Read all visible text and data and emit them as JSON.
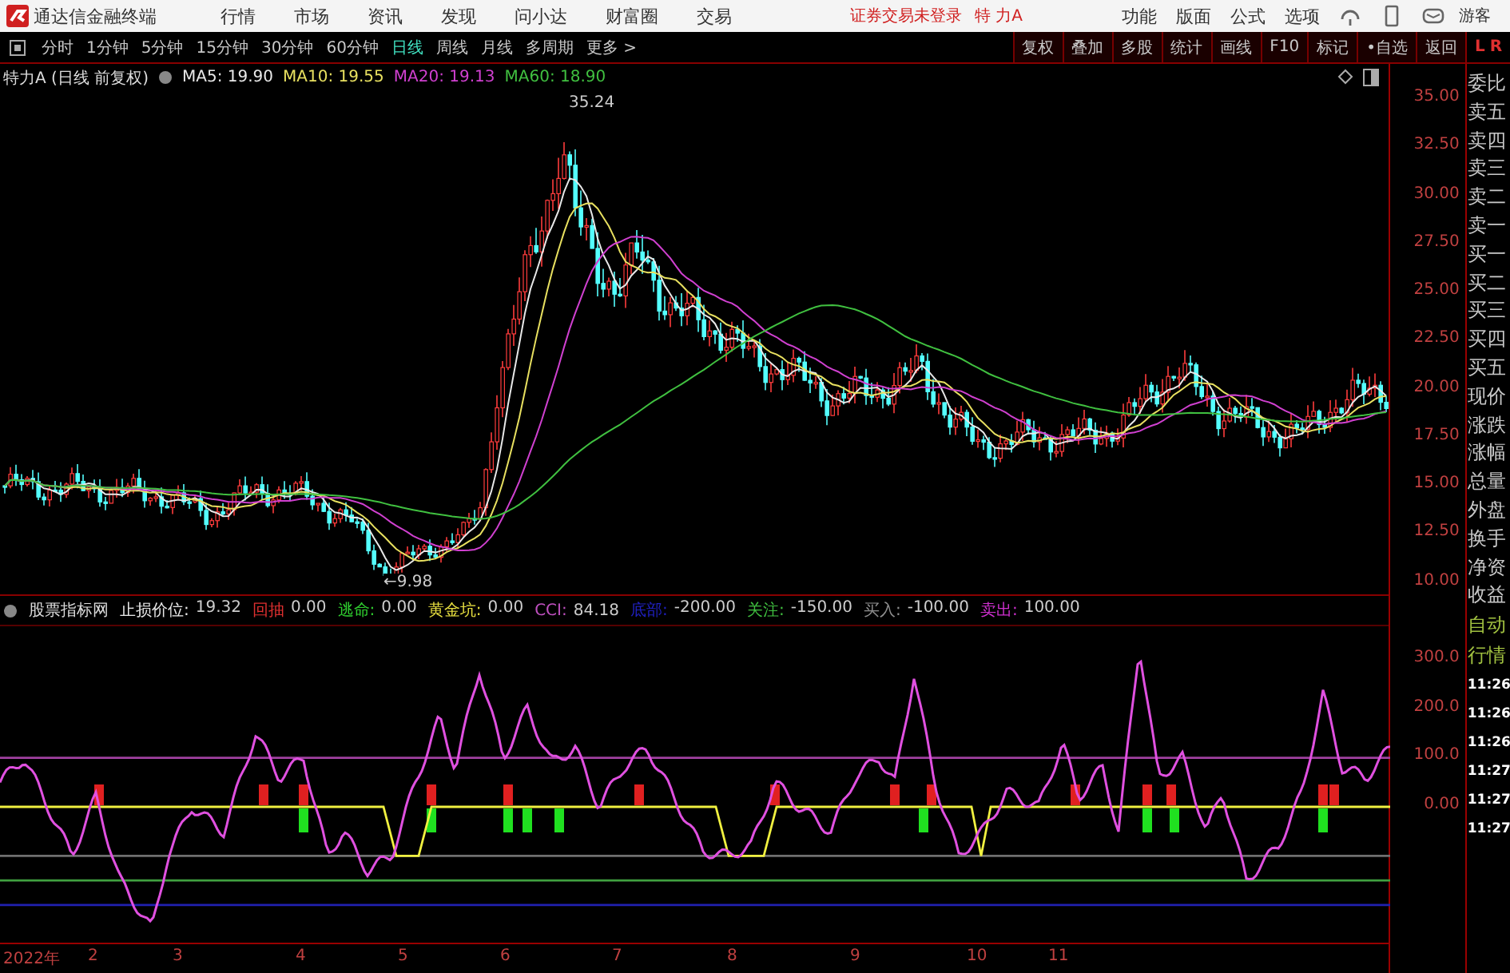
{
  "app": {
    "title": "通达信金融终端",
    "menu": [
      "行情",
      "市场",
      "资讯",
      "发现",
      "问小达",
      "财富圈",
      "交易"
    ],
    "login_notice": "证券交易未登录",
    "stock_name": "特 力A",
    "right_menu": [
      "功能",
      "版面",
      "公式",
      "选项"
    ],
    "user": "游客"
  },
  "periods": [
    {
      "label": "分时",
      "selected": false
    },
    {
      "label": "1分钟",
      "selected": false
    },
    {
      "label": "5分钟",
      "selected": false
    },
    {
      "label": "15分钟",
      "selected": false
    },
    {
      "label": "30分钟",
      "selected": false
    },
    {
      "label": "60分钟",
      "selected": false
    },
    {
      "label": "日线",
      "selected": true
    },
    {
      "label": "周线",
      "selected": false
    },
    {
      "label": "月线",
      "selected": false
    },
    {
      "label": "多周期",
      "selected": false
    },
    {
      "label": "更多 >",
      "selected": false
    }
  ],
  "tools": [
    "复权",
    "叠加",
    "多股",
    "统计",
    "画线",
    "F10",
    "标记",
    "•自选",
    "返回"
  ],
  "corner": [
    "L",
    "R"
  ],
  "price_chart": {
    "title": "特力A (日线 前复权)",
    "ma": [
      {
        "label": "MA5:",
        "value": "19.90",
        "color": "#e8e8e8"
      },
      {
        "label": "MA10:",
        "value": "19.55",
        "color": "#e8e060"
      },
      {
        "label": "MA20:",
        "value": "19.13",
        "color": "#d040d0"
      },
      {
        "label": "MA60:",
        "value": "18.90",
        "color": "#40c040"
      }
    ],
    "high_label": "35.24",
    "low_label": "←9.98",
    "y_ticks": [
      "35.00",
      "32.50",
      "30.00",
      "27.50",
      "25.00",
      "22.50",
      "20.00",
      "17.50",
      "15.00",
      "12.50",
      "10.00"
    ]
  },
  "indicator": {
    "name": "股票指标网",
    "items": [
      {
        "label": "止损价位:",
        "value": "19.32",
        "color": "#e8e8e8"
      },
      {
        "label": "回抽",
        "value": "0.00",
        "color": "#e03030"
      },
      {
        "label": "逃命:",
        "value": "0.00",
        "color": "#30d030"
      },
      {
        "label": "黄金坑:",
        "value": "0.00",
        "color": "#e8e040"
      },
      {
        "label": "CCI:",
        "value": "84.18",
        "color": "#c050c0"
      },
      {
        "label": "底部:",
        "value": "-200.00",
        "color": "#2020c0"
      },
      {
        "label": "关注:",
        "value": "-150.00",
        "color": "#40c040"
      },
      {
        "label": "买入:",
        "value": "-100.00",
        "color": "#909090"
      },
      {
        "label": "卖出:",
        "value": "100.00",
        "color": "#d030d0"
      }
    ],
    "y_ticks": [
      "300.0",
      "200.0",
      "100.0",
      "0.00"
    ]
  },
  "x_axis": [
    "2022年",
    "2",
    "3",
    "4",
    "5",
    "6",
    "7",
    "8",
    "9",
    "10",
    "11"
  ],
  "quote_panel": {
    "labels": [
      "委比",
      "卖五",
      "卖四",
      "卖三",
      "卖二",
      "卖一",
      "买一",
      "买二",
      "买三",
      "买四",
      "买五",
      "现价",
      "涨跌",
      "涨幅",
      "总量",
      "外盘",
      "换手",
      "净资",
      "收益"
    ],
    "modes": [
      "自动",
      "行情"
    ],
    "times": [
      "11:26",
      "11:26",
      "11:26",
      "11:27",
      "11:27",
      "11:27"
    ]
  }
}
